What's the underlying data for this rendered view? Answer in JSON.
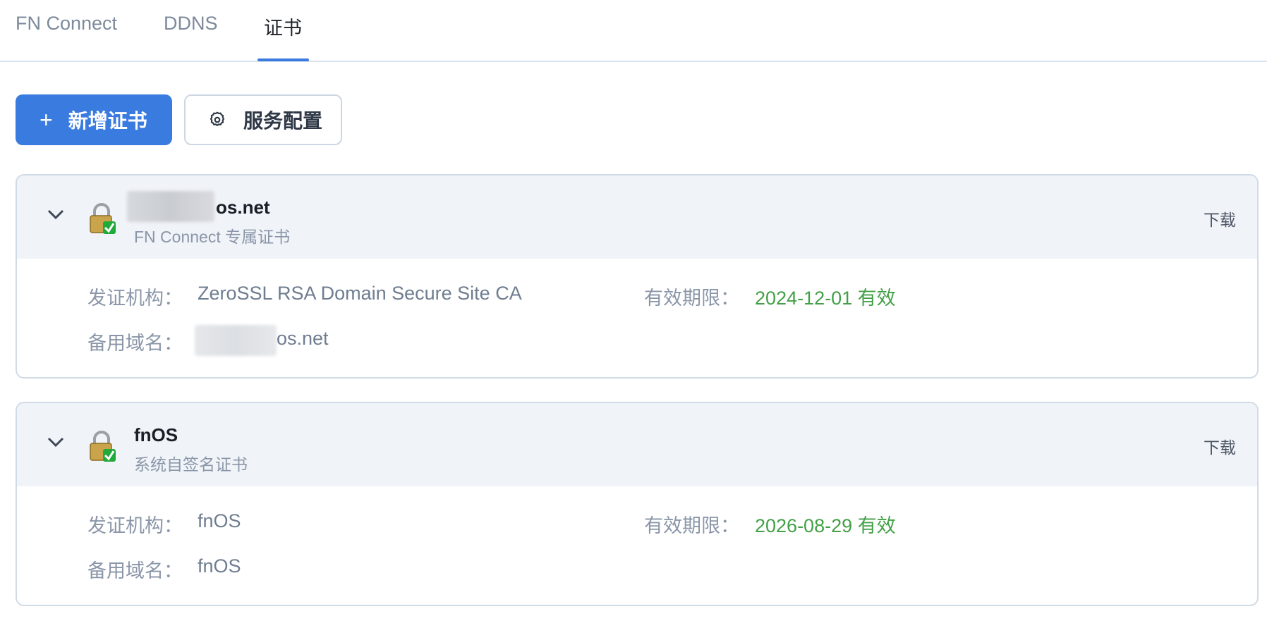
{
  "tabs": [
    {
      "label": "FN Connect",
      "active": false
    },
    {
      "label": "DDNS",
      "active": false
    },
    {
      "label": "证书",
      "active": true
    }
  ],
  "toolbar": {
    "add_label": "新增证书",
    "add_icon": "plus-icon",
    "config_label": "服务配置",
    "config_icon": "gear-icon"
  },
  "colors": {
    "accent": "#3a7be0",
    "valid": "#43a047",
    "muted": "#8a96a8"
  },
  "certificates": [
    {
      "title": "os.net",
      "subtitle": "FN Connect 专属证书",
      "download": "下载",
      "issuer_label": "发证机构：",
      "issuer": "ZeroSSL RSA Domain Secure Site CA",
      "expiry_label": "有效期限：",
      "expiry": "2024-12-01 有效",
      "alt_label": "备用域名：",
      "alt": "os.net"
    },
    {
      "title": "fnOS",
      "subtitle": "系统自签名证书",
      "download": "下载",
      "issuer_label": "发证机构：",
      "issuer": "fnOS",
      "expiry_label": "有效期限：",
      "expiry": "2026-08-29 有效",
      "alt_label": "备用域名：",
      "alt": "fnOS"
    }
  ]
}
